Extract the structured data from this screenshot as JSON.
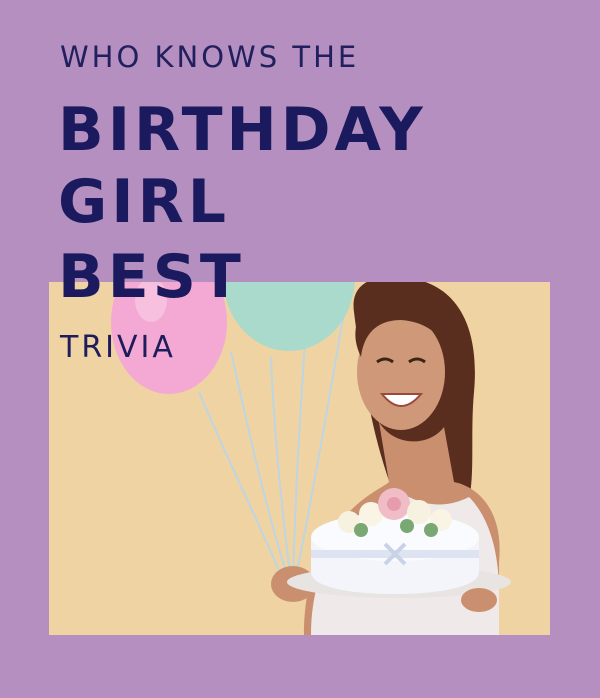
{
  "card": {
    "kicker": "WHO KNOWS THE",
    "headline_line1": "BIRTHDAY",
    "headline_line2": "GIRL",
    "headline_line3": "BEST",
    "subtitle": "TRIVIA"
  },
  "colors": {
    "background": "#b48fc0",
    "photo_backdrop": "#efd3a3",
    "title_text": "#1b1a5e"
  },
  "photo": {
    "subject": "woman-holding-balloons-and-cake-illustration"
  }
}
